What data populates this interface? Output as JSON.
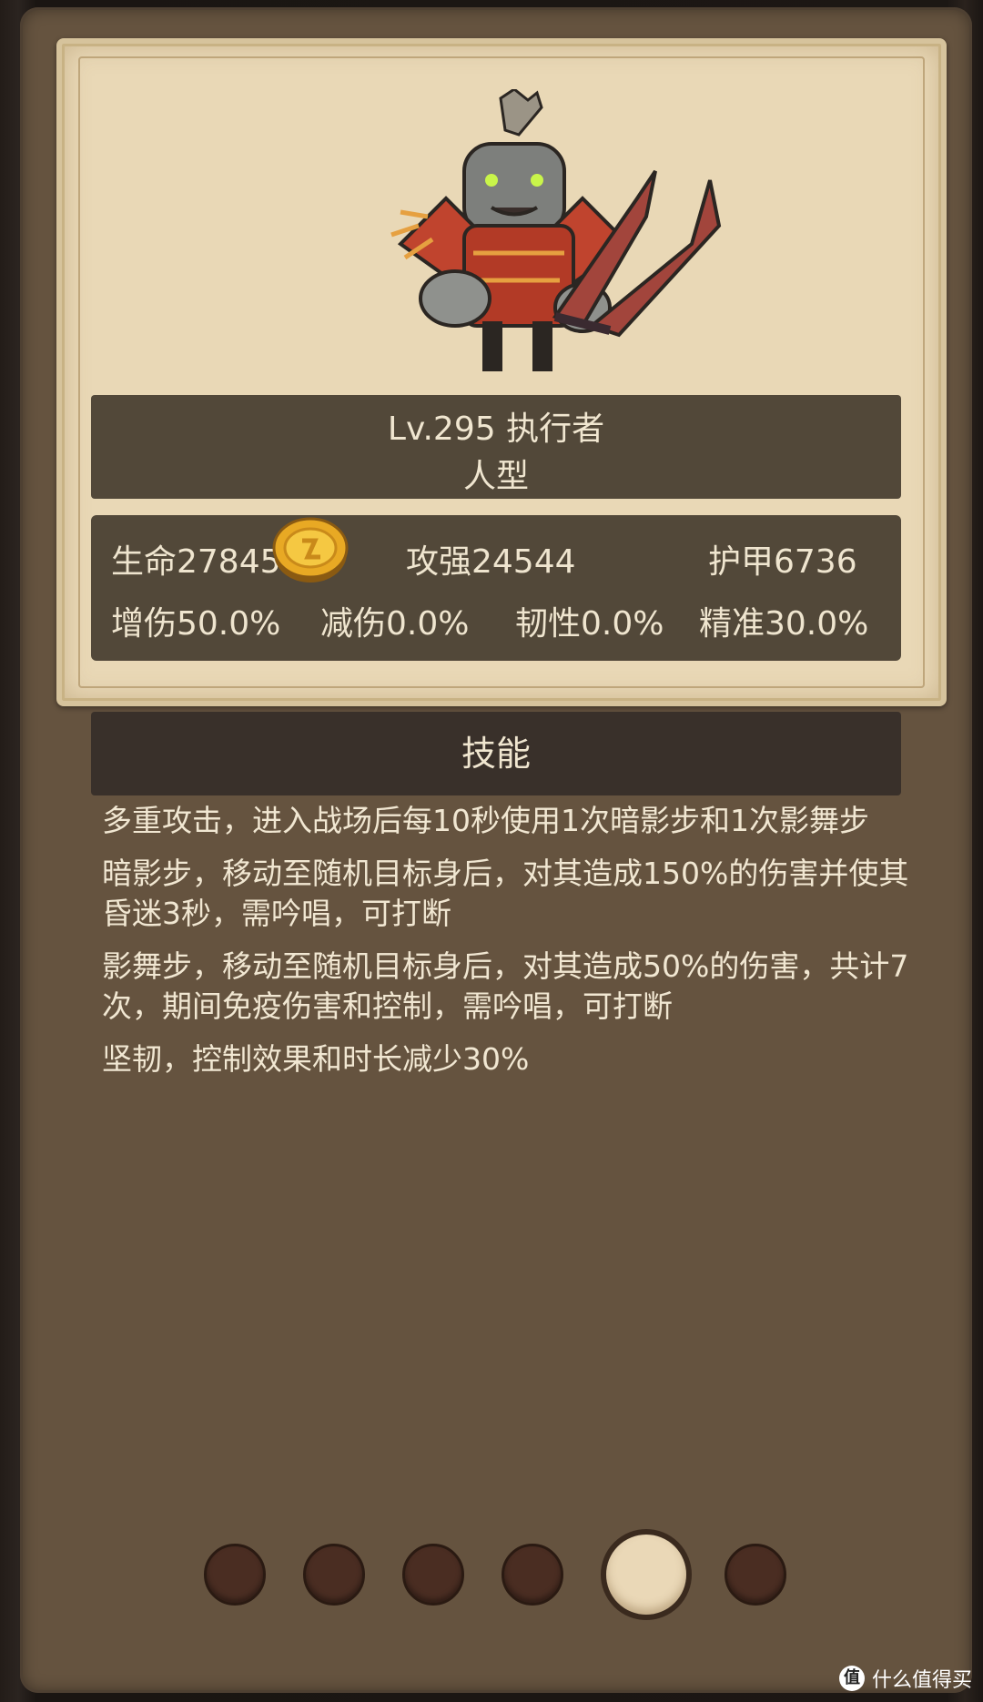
{
  "card": {
    "name_line": "Lv.295 执行者",
    "type_line": "人型",
    "stats": {
      "hp": "生命27845",
      "attack": "攻强24544",
      "armor": "护甲6736",
      "dmg_up": "增伤50.0%",
      "dmg_down": "减伤0.0%",
      "toughness": "韧性0.0%",
      "precision": "精准30.0%"
    },
    "avatar_icon": "orc-executioner-avatar",
    "coin_icon": "gold-coin-icon"
  },
  "skills": {
    "header": "技能",
    "items": [
      "多重攻击，进入战场后每10秒使用1次暗影步和1次影舞步",
      "暗影步，移动至随机目标身后，对其造成150%的伤害并使其昏迷3秒，需吟唱，可打断",
      "影舞步，移动至随机目标身后，对其造成50%的伤害，共计7次，期间免疫伤害和控制，需吟唱，可打断",
      "坚韧，控制效果和时长减少30%"
    ]
  },
  "pager": {
    "count": 6,
    "active_index": 4
  },
  "watermark": {
    "logo": "值",
    "text": "什么值得买"
  },
  "colors": {
    "panel": "#65533f",
    "card": "#e9d8b6",
    "banner": "#524839",
    "skill_header": "#39302a",
    "dot": "#4a2d22",
    "dot_active": "#ead8b7"
  }
}
